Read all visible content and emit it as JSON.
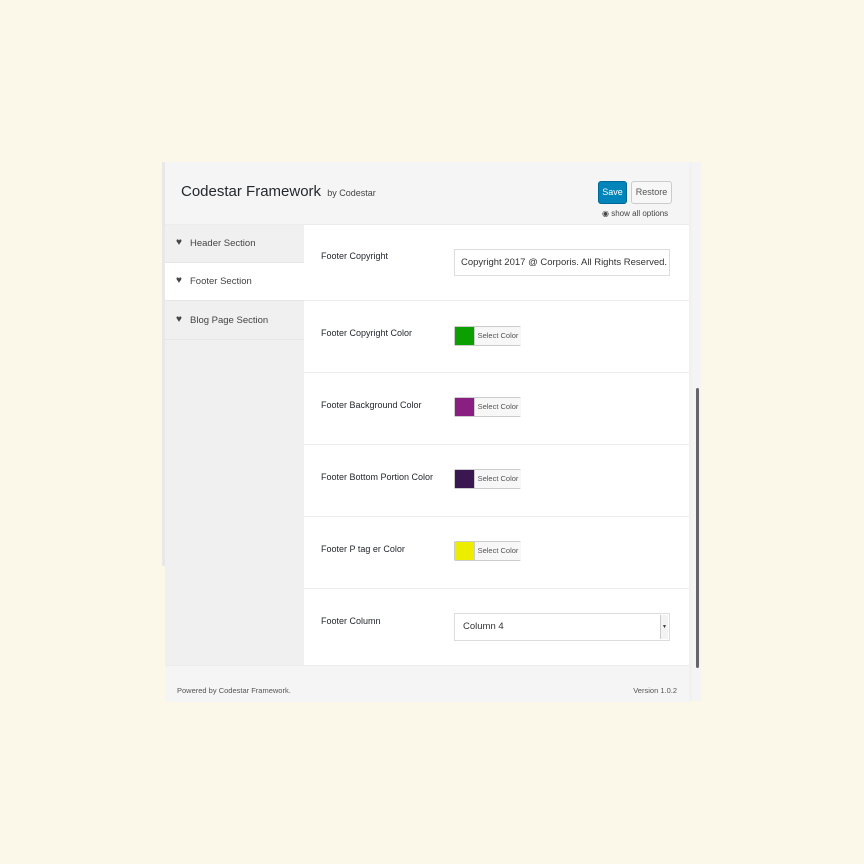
{
  "header": {
    "title": "Codestar Framework",
    "by": "by Codestar",
    "save_label": "Save",
    "restore_label": "Restore",
    "show_all": "show all options"
  },
  "sidebar": {
    "items": [
      {
        "label": "Header Section",
        "icon": "heart-icon"
      },
      {
        "label": "Footer Section",
        "icon": "heart-icon",
        "active": true
      },
      {
        "label": "Blog Page Section",
        "icon": "heart-icon"
      }
    ]
  },
  "fields": {
    "copyright": {
      "label": "Footer Copyright",
      "value": "Copyright 2017 @ Corporis. All Rights Reserved."
    },
    "copyright_color": {
      "label": "Footer Copyright Color",
      "button": "Select Color",
      "color": "#0ba000"
    },
    "background_color": {
      "label": "Footer Background Color",
      "button": "Select Color",
      "color": "#8a1f82"
    },
    "bottom_color": {
      "label": "Footer Bottom Portion Color",
      "button": "Select Color",
      "color": "#3b1752"
    },
    "ptag_color": {
      "label": "Footer P tag er Color",
      "button": "Select Color",
      "color": "#eded00"
    },
    "column": {
      "label": "Footer Column",
      "value": "Column 4"
    }
  },
  "footer": {
    "powered": "Powered by Codestar Framework.",
    "version": "Version 1.0.2"
  },
  "colors": {
    "accent": "#0085ba",
    "background": "#fbf8e9"
  }
}
